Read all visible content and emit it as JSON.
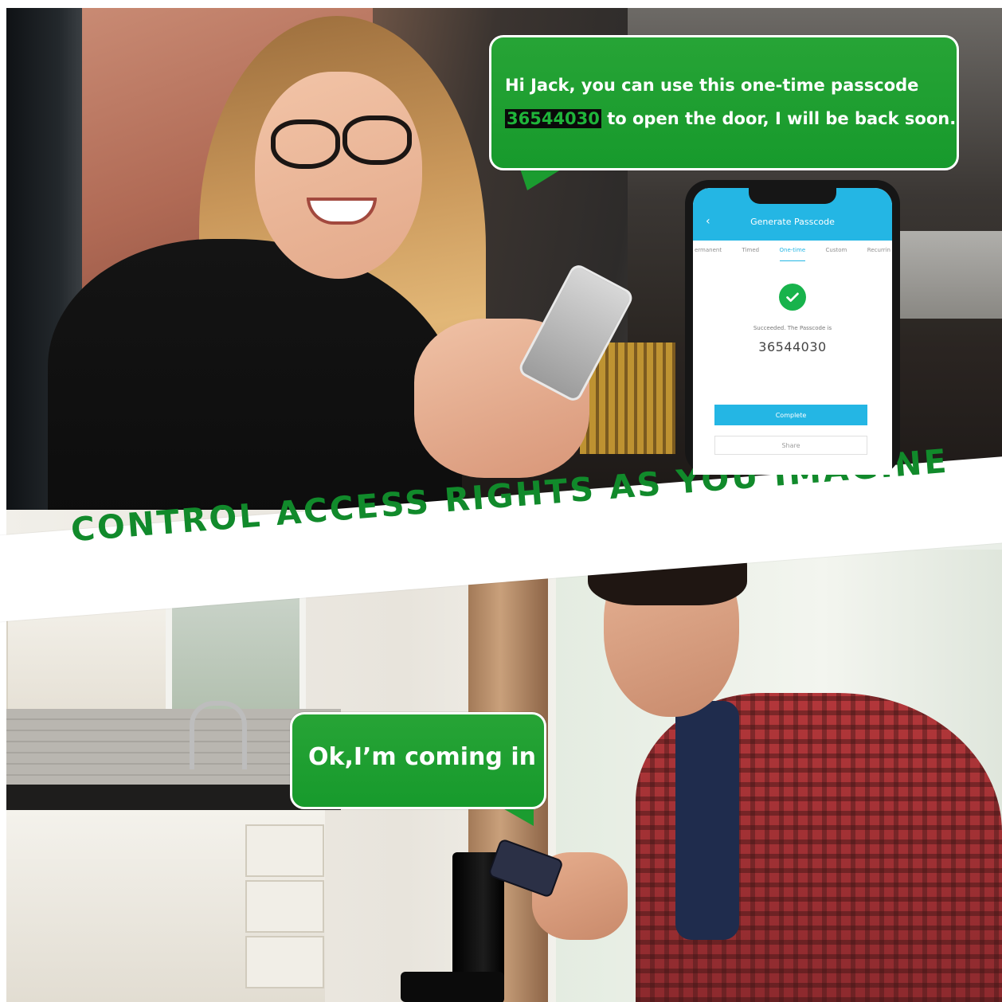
{
  "top_bubble": {
    "line1": "Hi Jack, you can use this one-time passcode",
    "code": "36544030",
    "line2_rest": " to open the door, I will be back soon."
  },
  "phone": {
    "title": "Generate Passcode",
    "back_icon": "chevron-left-icon",
    "tabs": [
      "ermanent",
      "Timed",
      "One-time",
      "Custom",
      "Recurrin"
    ],
    "active_tab": "One-time",
    "success_text": "Succeeded. The Passcode is",
    "code": "36544030",
    "complete_label": "Complete",
    "share_label": "Share",
    "accent_color": "#24b6e4",
    "success_icon": "check-circle-icon"
  },
  "banner": {
    "text": "CONTROL ACCESS RIGHTS AS YOU IMAGINE",
    "color": "#118a2b"
  },
  "bottom_bubble": {
    "text": "Ok,I’m coming in"
  },
  "colors": {
    "bubble_green": "#1f9f33",
    "banner_green": "#118a2b",
    "app_blue": "#24b6e4"
  }
}
